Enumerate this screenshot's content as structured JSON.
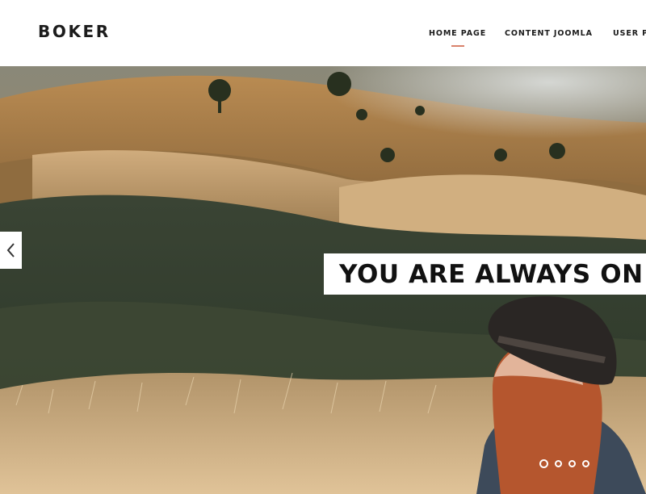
{
  "header": {
    "logo": "BOKER",
    "nav": [
      {
        "label": "HOME PAGE",
        "active": true
      },
      {
        "label": "CONTENT JOOMLA",
        "active": false
      },
      {
        "label": "USER PA",
        "active": false
      }
    ],
    "accent_color": "#d9826b"
  },
  "hero": {
    "caption": "YOU ARE ALWAYS ON",
    "prev_icon": "chevron-left-icon",
    "slides_count": 4,
    "active_slide": 1
  }
}
